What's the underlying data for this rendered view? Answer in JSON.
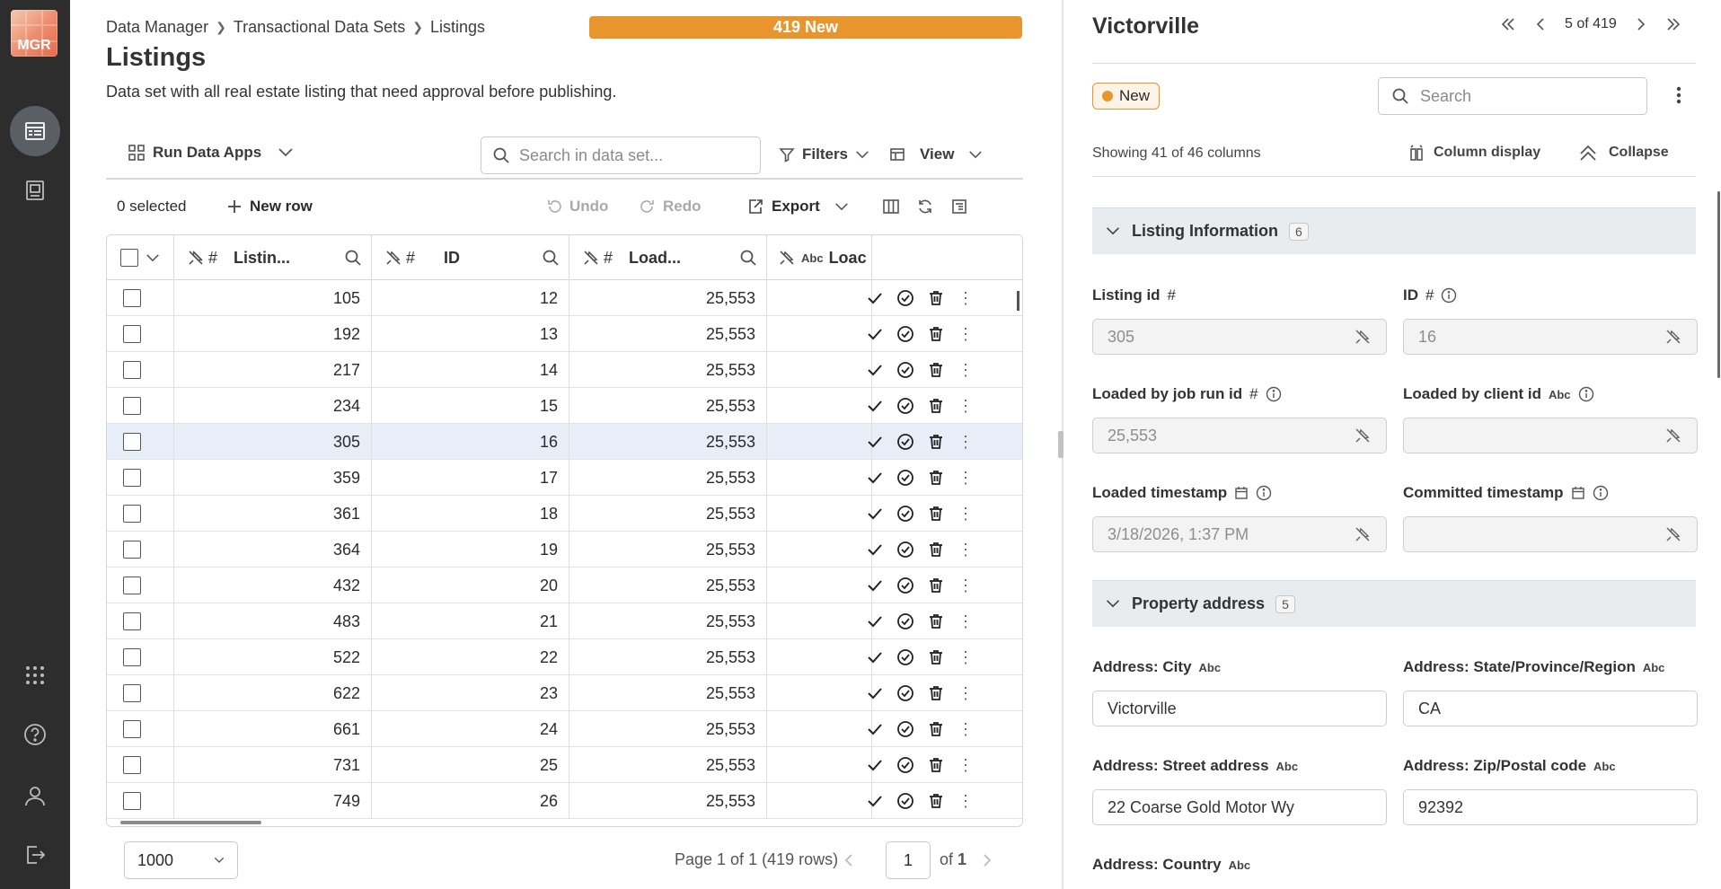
{
  "sidebar": {
    "logo_text": "MGR",
    "icons": [
      "data-grid-icon",
      "catalog-icon",
      "apps-grid-icon",
      "help-icon",
      "user-icon",
      "logout-icon"
    ]
  },
  "header": {
    "breadcrumb": [
      "Data Manager",
      "Transactional Data Sets",
      "Listings"
    ],
    "new_count_label": "419 New",
    "title": "Listings",
    "description": "Data set with all real estate listing that need approval before publishing."
  },
  "toolbar": {
    "run_apps": "Run Data Apps",
    "search_placeholder": "Search in data set...",
    "filters": "Filters",
    "view": "View",
    "selected": "0 selected",
    "new_row": "New row",
    "undo": "Undo",
    "redo": "Redo",
    "export": "Export"
  },
  "table": {
    "columns": [
      {
        "label": "Listin...",
        "type": "#"
      },
      {
        "label": "ID",
        "type": "#"
      },
      {
        "label": "Load...",
        "type": "#"
      },
      {
        "label": "Loac",
        "type": "Abc"
      }
    ],
    "rows": [
      {
        "listing": "105",
        "id": "12",
        "loaded": "25,553"
      },
      {
        "listing": "192",
        "id": "13",
        "loaded": "25,553"
      },
      {
        "listing": "217",
        "id": "14",
        "loaded": "25,553"
      },
      {
        "listing": "234",
        "id": "15",
        "loaded": "25,553"
      },
      {
        "listing": "305",
        "id": "16",
        "loaded": "25,553"
      },
      {
        "listing": "359",
        "id": "17",
        "loaded": "25,553"
      },
      {
        "listing": "361",
        "id": "18",
        "loaded": "25,553"
      },
      {
        "listing": "364",
        "id": "19",
        "loaded": "25,553"
      },
      {
        "listing": "432",
        "id": "20",
        "loaded": "25,553"
      },
      {
        "listing": "483",
        "id": "21",
        "loaded": "25,553"
      },
      {
        "listing": "522",
        "id": "22",
        "loaded": "25,553"
      },
      {
        "listing": "622",
        "id": "23",
        "loaded": "25,553"
      },
      {
        "listing": "661",
        "id": "24",
        "loaded": "25,553"
      },
      {
        "listing": "731",
        "id": "25",
        "loaded": "25,553"
      },
      {
        "listing": "749",
        "id": "26",
        "loaded": "25,553"
      }
    ],
    "selected_row_index": 4
  },
  "footer": {
    "page_size": "1000",
    "page_info": "Page 1 of 1 (419 rows)",
    "page_value": "1",
    "of_label": "of",
    "total_pages": "1"
  },
  "panel": {
    "title": "Victorville",
    "position": "5 of 419",
    "status": "New",
    "search_placeholder": "Search",
    "showing": "Showing 41 of 46 columns",
    "column_display": "Column display",
    "collapse": "Collapse",
    "sections": [
      {
        "title": "Listing Information",
        "count": "6"
      },
      {
        "title": "Property address",
        "count": "5"
      }
    ],
    "fields": {
      "listing_id": {
        "label": "Listing id",
        "type": "#",
        "value": "305"
      },
      "id": {
        "label": "ID",
        "type": "#",
        "value": "16"
      },
      "loaded_job": {
        "label": "Loaded by job run id",
        "type": "#",
        "value": "25,553"
      },
      "loaded_client": {
        "label": "Loaded by client id",
        "type": "Abc",
        "value": ""
      },
      "loaded_ts": {
        "label": "Loaded timestamp",
        "value": "3/18/2026, 1:37 PM"
      },
      "committed_ts": {
        "label": "Committed timestamp",
        "value": ""
      },
      "city": {
        "label": "Address: City",
        "type": "Abc",
        "value": "Victorville"
      },
      "state": {
        "label": "Address: State/Province/Region",
        "type": "Abc",
        "value": "CA"
      },
      "street": {
        "label": "Address: Street address",
        "type": "Abc",
        "value": "22 Coarse Gold Motor Wy"
      },
      "zip": {
        "label": "Address: Zip/Postal code",
        "type": "Abc",
        "value": "92392"
      },
      "country": {
        "label": "Address: Country",
        "type": "Abc"
      }
    }
  },
  "colors": {
    "accent": "#e8952e",
    "rail": "#2d2d2d",
    "selected_row": "#e7eef8",
    "section_bg": "#e9ecef"
  }
}
